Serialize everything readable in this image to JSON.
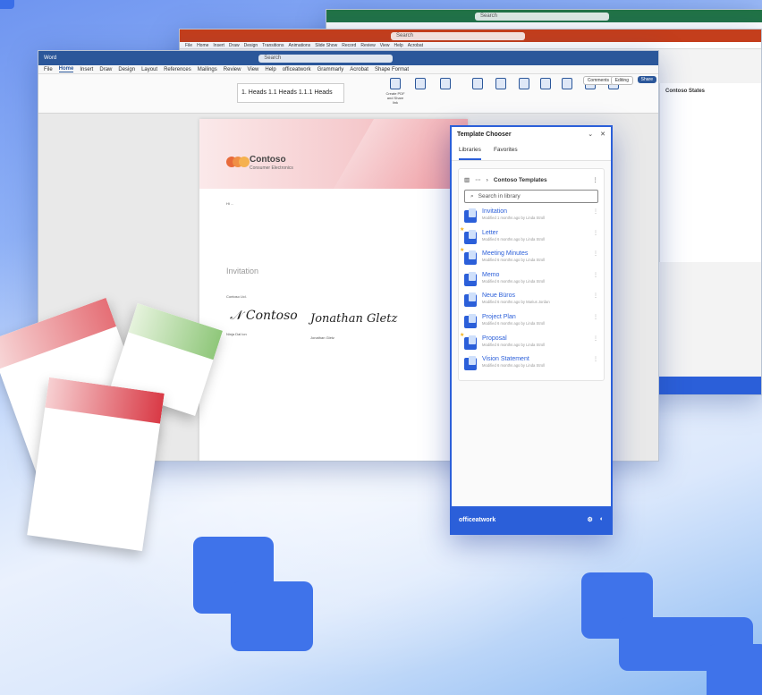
{
  "background_windows": {
    "excel": {
      "accent": "#217346",
      "search": "Search"
    },
    "powerpoint": {
      "accent": "#c43e1c",
      "search": "Search",
      "menu": [
        "File",
        "Home",
        "Insert",
        "Draw",
        "Design",
        "Transitions",
        "Animations",
        "Slide Show",
        "Record",
        "Review",
        "View",
        "Help",
        "Acrobat"
      ]
    }
  },
  "word": {
    "accent": "#2b579a",
    "title": "Word",
    "search": "Search",
    "menu": [
      "File",
      "Home",
      "Insert",
      "Draw",
      "Design",
      "Layout",
      "References",
      "Mailings",
      "Review",
      "View",
      "Help",
      "officeatwork",
      "Grammarly",
      "Acrobat",
      "Shape Format"
    ],
    "active_tab": "Home",
    "style_gallery": "1. Heads 1.1 Heads 1.1.1 Heads",
    "ribbon_buttons": [
      "Create PDF and Share link",
      "Create PDF and Share via Outlook",
      "Request Signatures",
      "Dictate",
      "Sensitivity",
      "Editor",
      "Add-ins",
      "Template Chooser",
      "Wizard",
      "Verifier"
    ],
    "comments": "Comments",
    "editing": "Editing",
    "share": "Share"
  },
  "document": {
    "company": "Contoso",
    "company_sub": "Consumer Electronics",
    "heading": "Invitation",
    "greeting": "Hi ...",
    "closing": "Contoso Ltd.",
    "signer1": "Ninja Dal lon",
    "signer2": "Jonathan Gletz"
  },
  "chooser": {
    "title": "Template Chooser",
    "tabs": [
      "Libraries",
      "Favorites"
    ],
    "active_tab": "Libraries",
    "library": "Contoso Templates",
    "search_placeholder": "Search in library",
    "items": [
      {
        "name": "Invitation",
        "meta": "Modified 1 months ago by Linda Stroll",
        "star": false
      },
      {
        "name": "Letter",
        "meta": "Modified 6 months ago by Linda Stroll",
        "star": true
      },
      {
        "name": "Meeting Minutes",
        "meta": "Modified 6 months ago by Linda Stroll",
        "star": true
      },
      {
        "name": "Memo",
        "meta": "Modified 6 months ago by Linda Stroll",
        "star": false
      },
      {
        "name": "Neue Büros",
        "meta": "Modified 6 months ago by Marius Jordan",
        "star": false
      },
      {
        "name": "Project Plan",
        "meta": "Modified 6 months ago by Linda Stroll",
        "star": false
      },
      {
        "name": "Proposal",
        "meta": "Modified 6 months ago by Linda Stroll",
        "star": true
      },
      {
        "name": "Vision Statement",
        "meta": "Modified 6 months ago by Linda Stroll",
        "star": false
      }
    ],
    "footer_brand": "officeatwork",
    "accent": "#2b5fd9"
  },
  "side_panel": {
    "title": "Contoso States"
  }
}
